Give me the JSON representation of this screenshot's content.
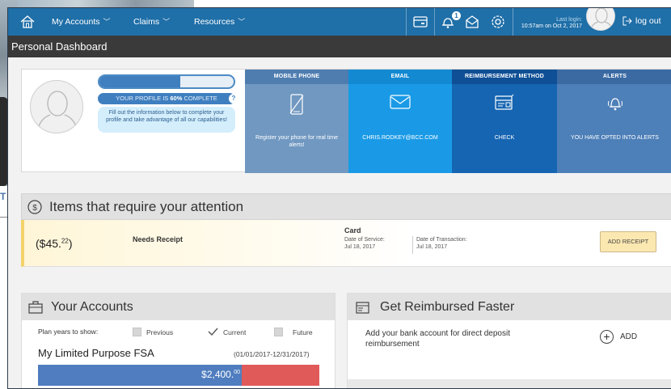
{
  "nav": {
    "my_accounts": "My Accounts",
    "claims": "Claims",
    "resources": "Resources",
    "notification_count": "1",
    "last_login_label": "Last login:",
    "last_login_value": "10:57am on Oct 2, 2017",
    "logout": "log out",
    "icons": [
      "home-icon",
      "card-icon",
      "bell-icon",
      "mail-icon",
      "gear-icon",
      "logout-icon"
    ]
  },
  "page_title": "Personal Dashboard",
  "profile": {
    "completion": 60,
    "status_prefix": "YOUR PROFILE IS ",
    "status_value": "60%",
    "status_suffix": " COMPLETE",
    "hint": "Fill out the information below to complete your profile and take advantage of all our capabilities!"
  },
  "tiles": {
    "phone": {
      "header": "MOBILE PHONE",
      "value": "Register your phone for real time alerts!"
    },
    "email": {
      "header": "EMAIL",
      "value": "CHRIS.RODKEY@BCC.COM"
    },
    "reimbursement": {
      "header": "REIMBURSEMENT METHOD",
      "value": "CHECK"
    },
    "alerts": {
      "header": "ALERTS",
      "value": "YOU HAVE OPTED INTO   ALERTS"
    }
  },
  "attention": {
    "title": "Items that require your attention",
    "items": [
      {
        "amount_main": "($45.",
        "amount_cents": "22",
        "amount_close": ")",
        "status": "Needs Receipt",
        "type": "Card",
        "date_of_service_label": "Date of Service:",
        "date_of_service": "Jul 18, 2017",
        "date_of_transaction_label": "Date of Transaction:",
        "date_of_transaction": "Jul 18, 2017",
        "action": "ADD RECEIPT"
      }
    ]
  },
  "accounts": {
    "title": "Your Accounts",
    "plan_years_label": "Plan years to show:",
    "options": [
      {
        "label": "Previous",
        "checked": false
      },
      {
        "label": "Current",
        "checked": true
      },
      {
        "label": "Future",
        "checked": false
      }
    ],
    "account_name": "My Limited Purpose FSA",
    "account_range": "(01/01/2017-12/31/2017)",
    "balance_main": "$2,400.",
    "balance_cents": "00",
    "balance_fraction": 0.725,
    "colors": {
      "balance": "#4f7dbf",
      "remaining": "#e05a5a"
    }
  },
  "reimburse": {
    "title": "Get Reimbursed Faster",
    "text": "Add your bank account for direct deposit reimbursement",
    "add_label": "ADD"
  }
}
